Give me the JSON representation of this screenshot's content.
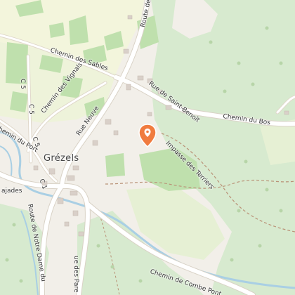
{
  "map": {
    "town_label": "Grézels",
    "roads": {
      "route_top": "Route de",
      "chemin_des_sables": "Chemin des Sables",
      "chemin_des_vignals": "Chemin des Vignals",
      "rue_neuve": "Rue Neuve",
      "rue_saint_benoit": "Rue de Saint-Benoît",
      "chemin_du_bos": "Chemin du Bos",
      "impasse_terriers": "Impasse des Terriers",
      "chemin_du_port": "hemin du Port",
      "c5_a": "C 5",
      "c5_b": "C 5",
      "c5_c": "C 5",
      "c1": "C 1",
      "ajades": "ajades",
      "route_notre_dame": "Route de Notre Dame du",
      "rue_bottom": "ue des Pare",
      "chemin_combe": "Chemin de Combe Pont"
    },
    "marker": {
      "icon": "map-pin-icon",
      "color": "#f07b3f"
    },
    "colors": {
      "land": "#f2efe9",
      "forest": "#d7eacf",
      "vineyard": "#bfe0ad",
      "meadow": "#e6f0d4",
      "farmland": "#f3f5dc",
      "road": "#ffffff",
      "road_outline": "#d9d2c6",
      "water": "#a9cfe4"
    }
  }
}
